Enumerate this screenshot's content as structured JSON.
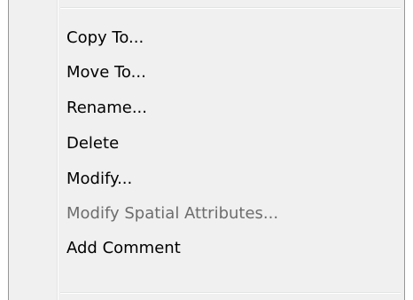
{
  "menu": {
    "items": [
      {
        "label": "Copy To...",
        "enabled": true
      },
      {
        "label": "Move To...",
        "enabled": true
      },
      {
        "label": "Rename...",
        "enabled": true
      },
      {
        "label": "Delete",
        "enabled": true
      },
      {
        "label": "Modify...",
        "enabled": true
      },
      {
        "label": "Modify Spatial Attributes...",
        "enabled": false
      },
      {
        "label": "Add Comment",
        "enabled": true
      }
    ]
  },
  "colors": {
    "menu_background": "#f0f0f0",
    "enabled_text": "#000000",
    "disabled_text": "#6d6d6d",
    "border": "#979797"
  }
}
